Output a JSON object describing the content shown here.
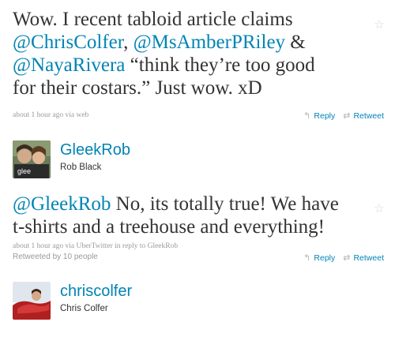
{
  "tweet1": {
    "seg1": "Wow. I recent tabloid article claims",
    "mention1": "@ChrisColfer",
    "seg2": ", ",
    "mention2": "@MsAmberPRiley",
    "seg3": " &",
    "mention3": "@NayaRivera",
    "seg4": " “think they’re too good",
    "seg5": "for their costars.” Just wow. xD",
    "time": "about 1 hour ago",
    "via_prefix": " via ",
    "source": "web",
    "reply_label": "Reply",
    "retweet_label": "Retweet"
  },
  "author1": {
    "screen_name": "GleekRob",
    "full_name": "Rob Black"
  },
  "tweet2": {
    "mention": "@GleekRob",
    "seg1": " No, its totally true! We have",
    "seg2": "t-shirts and a treehouse and everything!",
    "time": "about 1 hour ago",
    "via_prefix": " via ",
    "source": "UberTwitter",
    "reply_prefix": " in reply to ",
    "reply_to": "GleekRob",
    "retweeted": "Retweeted by 10 people",
    "reply_label": "Reply",
    "retweet_label": "Retweet"
  },
  "author2": {
    "screen_name": "chriscolfer",
    "full_name": "Chris Colfer"
  },
  "icons": {
    "favorite": "star-icon",
    "reply": "reply-arrow-icon",
    "retweet": "retweet-icon"
  },
  "colors": {
    "link": "#0084b4",
    "text": "#333333",
    "meta": "#999999"
  }
}
